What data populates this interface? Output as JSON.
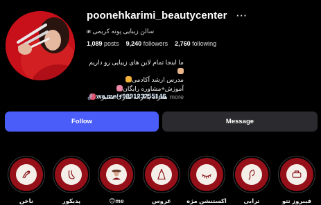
{
  "profile": {
    "username": "poonehkarimi_beautycenter",
    "category": "سالن زیبایی پونه کریمی",
    "category_badge": "IR",
    "posts_count": "1,089",
    "posts_label": "posts",
    "followers_count": "9,240",
    "followers_label": "followers",
    "following_count": "2,760",
    "following_label": "following",
    "bio_lines": [
      "ما اینجا تمام لاین های زیبایی رو داریم",
      "مدرس ارشد آکادمی",
      "آموزش+مشاوره رایگان",
      "همراه با ارائه مدرک معتبر..."
    ],
    "bio_more": "more",
    "link": "wa.me/+989123255146"
  },
  "actions": {
    "follow_label": "Follow",
    "message_label": "Message"
  },
  "highlights": [
    {
      "label": "ناخن",
      "icon": "nail-icon"
    },
    {
      "label": "پدیکور",
      "icon": "pedicure-icon"
    },
    {
      "label": "me😊",
      "icon": "me-icon"
    },
    {
      "label": "عروس",
      "icon": "bride-icon"
    },
    {
      "label": "اکستنشن مژه",
      "icon": "eyelash-icon"
    },
    {
      "label": "ترایی",
      "icon": "face-icon"
    },
    {
      "label": "فیبروز تتو",
      "icon": "brush-icon"
    }
  ],
  "colors": {
    "follow_button": "#4a5df9",
    "message_button": "#2b2b2f",
    "highlight_red": "#951019",
    "background": "#000000"
  }
}
